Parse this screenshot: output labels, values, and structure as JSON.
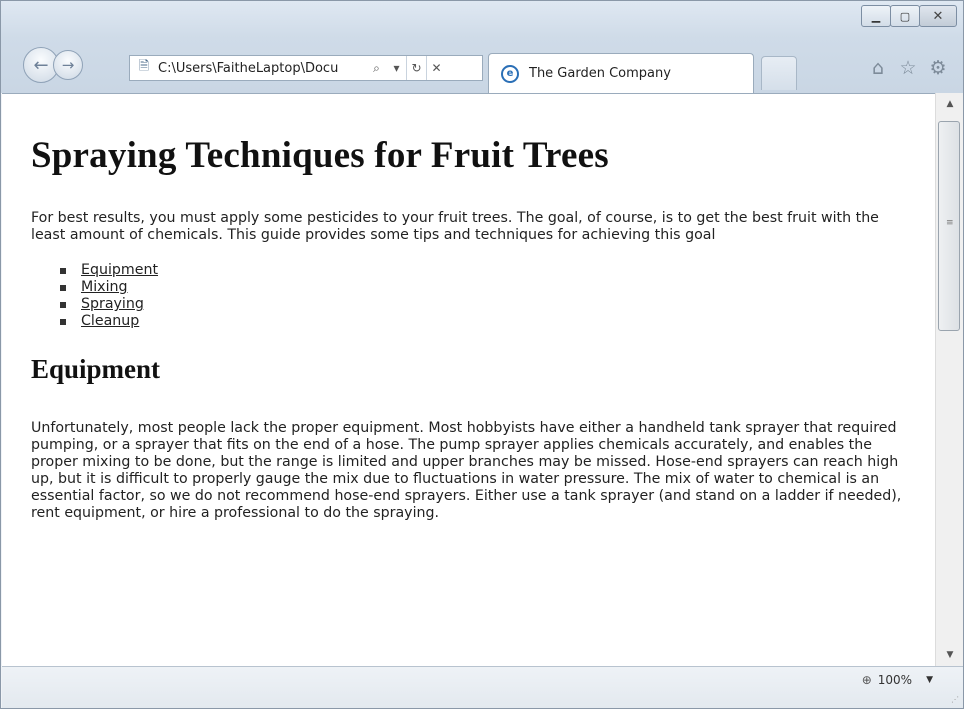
{
  "window": {
    "minimize_icon": "minimize-icon",
    "maximize_icon": "maximize-icon",
    "close_icon": "close-icon"
  },
  "toolbar": {
    "address": "C:\\Users\\FaitheLaptop\\Docu",
    "tab_title": "The Garden Company",
    "icons": [
      "back-icon",
      "forward-icon",
      "page-icon",
      "search-icon",
      "dropdown-icon",
      "refresh-icon",
      "stop-icon",
      "home-icon",
      "favorites-icon",
      "settings-icon"
    ]
  },
  "page": {
    "title": "Spraying Techniques for Fruit Trees",
    "intro": "For best results, you must apply some pesticides to your fruit trees. The goal, of course, is to get the best fruit with the least amount of chemicals. This guide provides some tips and techniques for achieving this goal",
    "toc": [
      "Equipment",
      "Mixing",
      "Spraying",
      "Cleanup"
    ],
    "section_heading": "Equipment",
    "section_body": "Unfortunately, most people lack the proper equipment. Most hobbyists have either a handheld tank sprayer that required pumping, or a sprayer that fits on the end of a hose. The pump sprayer applies chemicals accurately, and enables the proper mixing to be done, but the range is limited and upper branches may be missed. Hose-end sprayers can reach high up, but it is difficult to properly gauge the mix due to fluctuations in water pressure. The mix of water to chemical is an essential factor, so we do not recommend hose-end sprayers. Either use a tank sprayer (and stand on a ladder if needed), rent equipment, or hire a professional to do the spraying."
  },
  "status": {
    "zoom": "100%"
  }
}
